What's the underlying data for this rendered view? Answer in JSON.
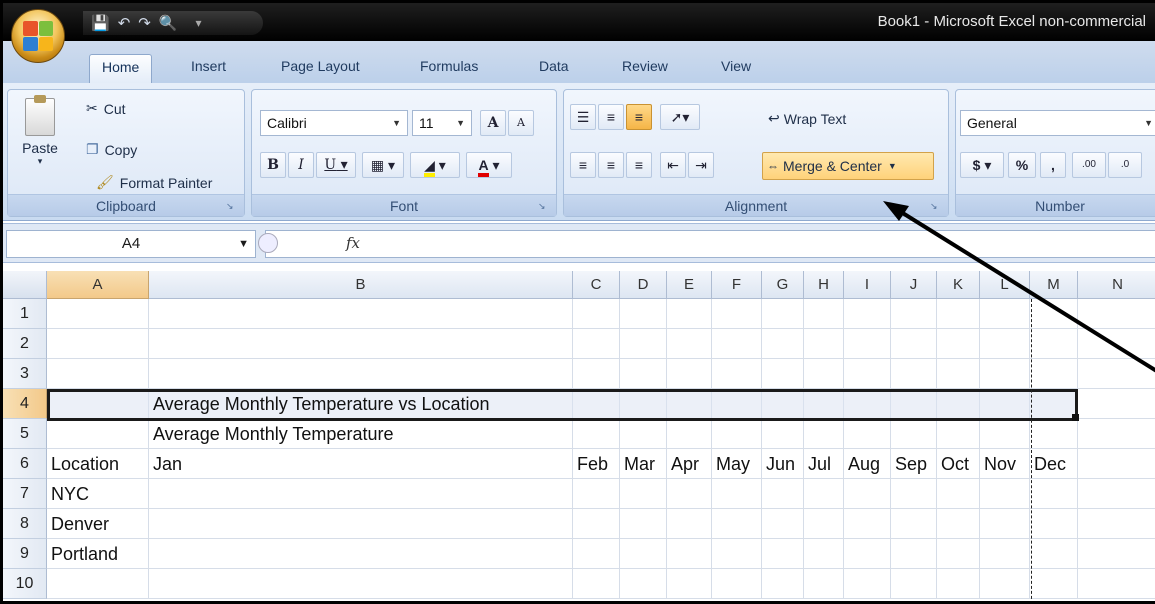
{
  "title": "Book1 - Microsoft Excel non-commercial",
  "tabs": [
    "Home",
    "Insert",
    "Page Layout",
    "Formulas",
    "Data",
    "Review",
    "View"
  ],
  "clipboard": {
    "paste": "Paste",
    "cut": "Cut",
    "copy": "Copy",
    "format_painter": "Format Painter",
    "label": "Clipboard"
  },
  "font": {
    "name": "Calibri",
    "size": "11",
    "bold": "B",
    "italic": "I",
    "underline": "U",
    "grow": "A",
    "shrink": "A",
    "color_letter": "A",
    "label": "Font"
  },
  "alignment": {
    "wrap": "Wrap Text",
    "merge": "Merge & Center",
    "label": "Alignment"
  },
  "number": {
    "format": "General",
    "currency": "$",
    "percent": "%",
    "comma": ",",
    "inc": ".00",
    "dec": ".0",
    "label": "Number"
  },
  "formula_bar": {
    "cell_ref": "A4",
    "fx": "fx"
  },
  "columns": [
    "A",
    "B",
    "C",
    "D",
    "E",
    "F",
    "G",
    "H",
    "I",
    "J",
    "K",
    "L",
    "M",
    "N"
  ],
  "rows": [
    "1",
    "2",
    "3",
    "4",
    "5",
    "6",
    "7",
    "8",
    "9",
    "10"
  ],
  "cells": {
    "b4": "Average Monthly Temperature vs Location",
    "b5": "Average Monthly Temperature",
    "a6": "Location",
    "b6": "Jan",
    "months": [
      "Feb",
      "Mar",
      "Apr",
      "May",
      "Jun",
      "Jul",
      "Aug",
      "Sep",
      "Oct",
      "Nov",
      "Dec"
    ],
    "a7": "NYC",
    "a8": "Denver",
    "a9": "Portland"
  },
  "colors": {
    "accent": "#f3c98a",
    "ribbon": "#d8e5f5",
    "titlebar": "#000000"
  }
}
